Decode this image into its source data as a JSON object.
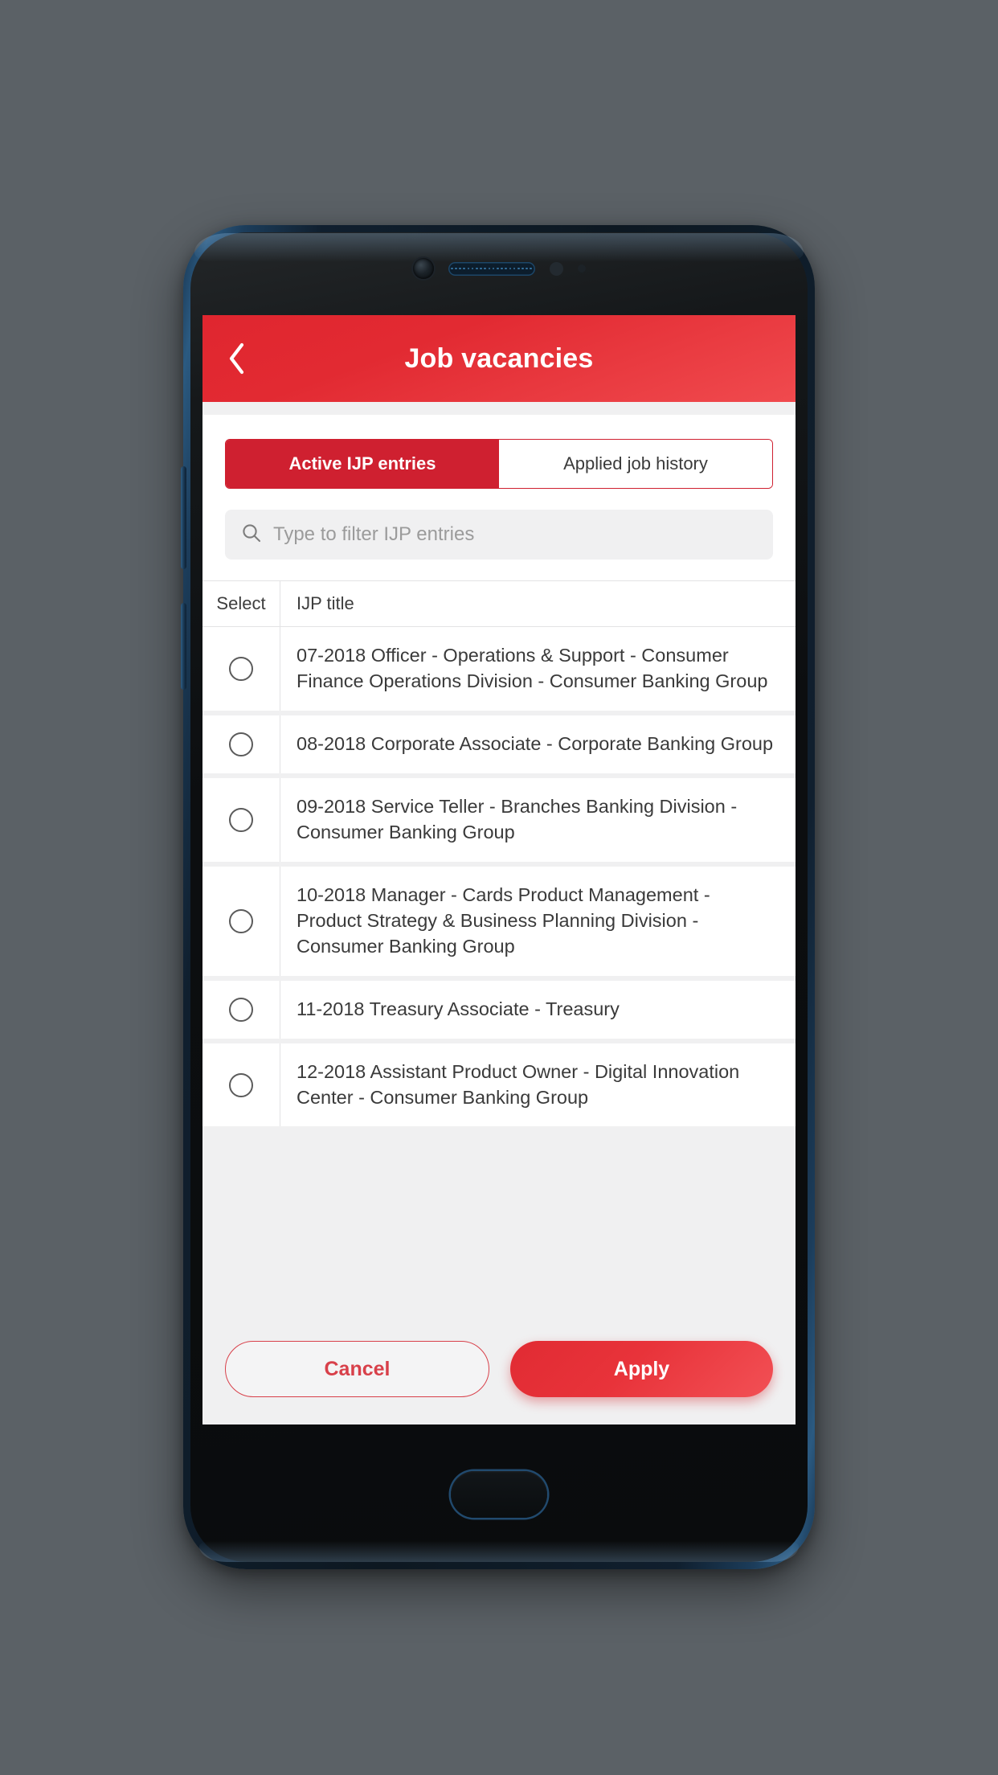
{
  "app": {
    "title": "Job vacancies",
    "back_icon": "chevron-left-icon",
    "brand_red": "#e0262f",
    "accent_red": "#cf2030"
  },
  "tabs": [
    {
      "label": "Active IJP entries",
      "active": true
    },
    {
      "label": "Applied job history",
      "active": false
    }
  ],
  "search": {
    "icon": "search-icon",
    "placeholder": "Type to filter IJP entries",
    "value": ""
  },
  "table": {
    "columns": [
      "Select",
      "IJP title"
    ],
    "rows": [
      {
        "selected": false,
        "title": "07-2018 Officer - Operations & Support - Consumer Finance Operations Division - Consumer Banking Group"
      },
      {
        "selected": false,
        "title": "08-2018 Corporate Associate - Corporate Banking Group"
      },
      {
        "selected": false,
        "title": "09-2018 Service Teller - Branches Banking Division - Consumer Banking Group"
      },
      {
        "selected": false,
        "title": "10-2018 Manager - Cards Product Management - Product Strategy & Business Planning Division - Consumer Banking Group"
      },
      {
        "selected": false,
        "title": "11-2018 Treasury Associate - Treasury"
      },
      {
        "selected": false,
        "title": "12-2018 Assistant Product Owner - Digital Innovation Center - Consumer Banking Group"
      }
    ]
  },
  "actions": {
    "cancel_label": "Cancel",
    "apply_label": "Apply"
  },
  "device": {
    "front_camera": "front-camera-icon",
    "earpiece": "earpiece-speaker-icon",
    "home_button": "home-button"
  }
}
